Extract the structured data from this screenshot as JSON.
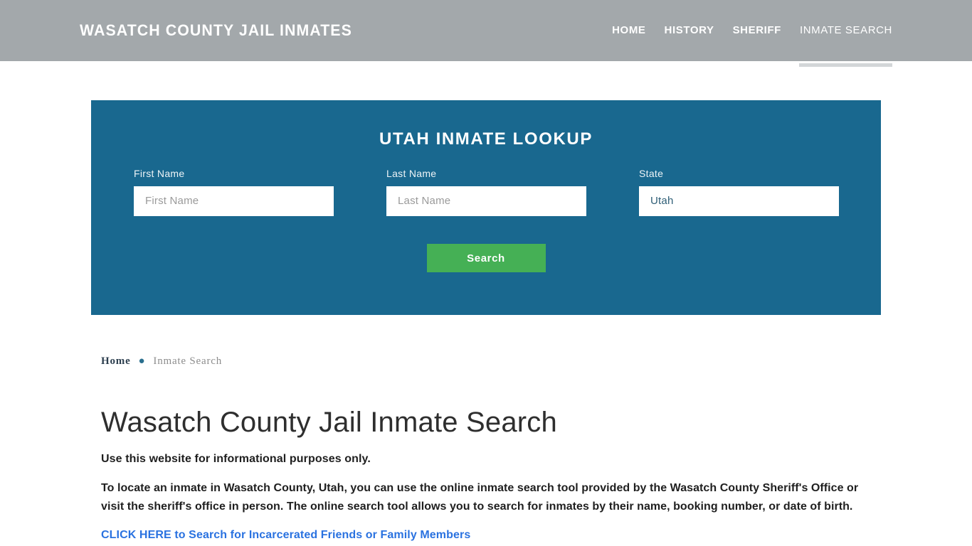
{
  "header": {
    "brand": "Wasatch County Jail Inmates",
    "nav": [
      {
        "label": "Home",
        "active": false
      },
      {
        "label": "History",
        "active": false
      },
      {
        "label": "Sheriff",
        "active": false
      },
      {
        "label": "Inmate Search",
        "active": true
      }
    ]
  },
  "lookup": {
    "title": "Utah Inmate Lookup",
    "fields": [
      {
        "label": "First Name",
        "placeholder": "First Name",
        "value": ""
      },
      {
        "label": "Last Name",
        "placeholder": "Last Name",
        "value": ""
      },
      {
        "label": "State",
        "placeholder": "State",
        "value": "Utah"
      }
    ],
    "submit_label": "Search",
    "panel_color": "#19688f",
    "submit_color": "#45b055"
  },
  "breadcrumb": {
    "home_label": "Home",
    "separator": "●",
    "current_label": "Inmate Search"
  },
  "main": {
    "title": "Wasatch County Jail Inmate Search",
    "lede": "Use this website for informational purposes only.",
    "paragraph": "To locate an inmate in Wasatch County, Utah, you can use the online inmate search tool provided by the Wasatch County Sheriff's Office or visit the sheriff's office in person. The online search tool allows you to search for inmates by their name, booking number, or date of birth.",
    "cta_label": "CLICK HERE to Search for Incarcerated Friends or Family Members",
    "cta_color": "#2a72e0"
  }
}
